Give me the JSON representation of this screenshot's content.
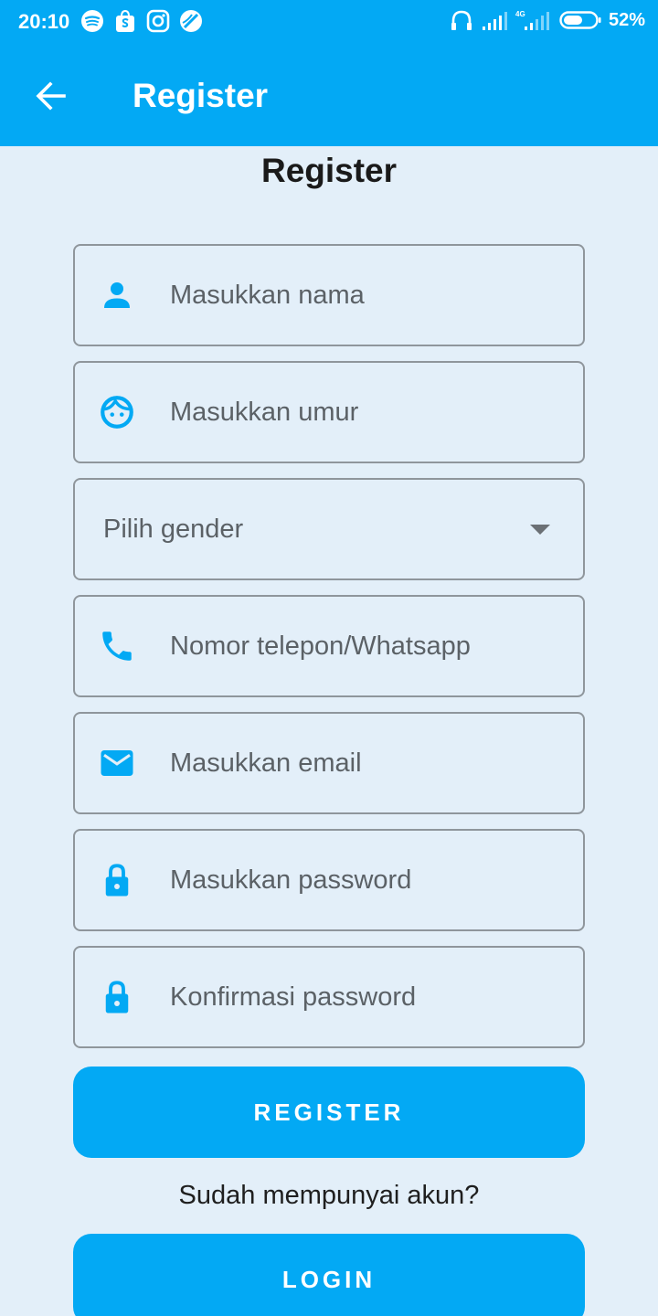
{
  "status_bar": {
    "time": "20:10",
    "battery": "52%",
    "icons_left": [
      "spotify-icon",
      "shopee-icon",
      "instagram-icon",
      "browser-icon"
    ],
    "icons_right": [
      "headphones-icon",
      "signal-icon",
      "signal-4g-icon",
      "battery-icon"
    ]
  },
  "app_bar": {
    "title": "Register",
    "back_icon": "arrow-left-icon"
  },
  "page": {
    "heading": "Register"
  },
  "form": {
    "name_placeholder": "Masukkan nama",
    "age_placeholder": "Masukkan umur",
    "gender_placeholder": "Pilih gender",
    "phone_placeholder": "Nomor telepon/Whatsapp",
    "email_placeholder": "Masukkan email",
    "password_placeholder": "Masukkan password",
    "confirm_password_placeholder": "Konfirmasi password"
  },
  "actions": {
    "register_label": "REGISTER",
    "have_account_text": "Sudah mempunyai akun?",
    "login_label": "LOGIN"
  },
  "colors": {
    "primary": "#03a9f4",
    "background": "#e3eff9",
    "field_border": "#8f969c",
    "placeholder": "#5b6166"
  }
}
